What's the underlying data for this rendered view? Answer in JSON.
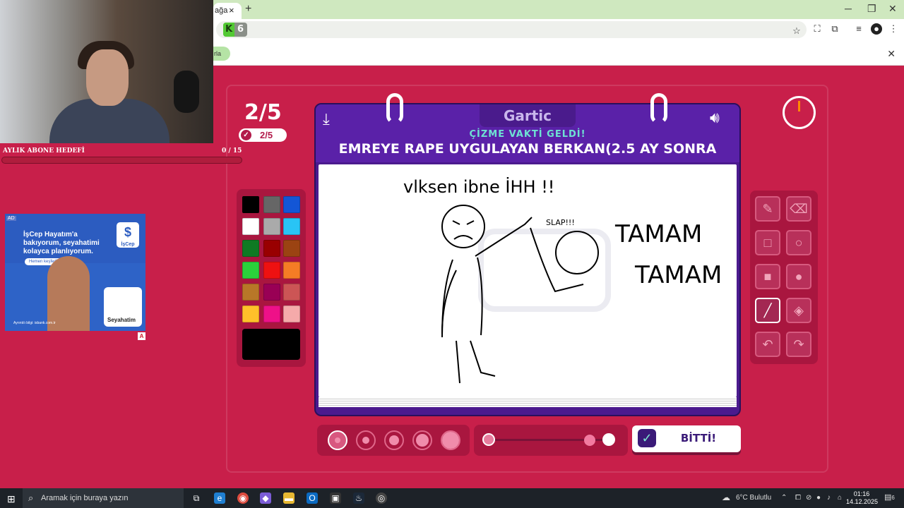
{
  "browser": {
    "tab_label": "ağa",
    "tab_close": "×",
    "new_tab": "+",
    "window_controls": [
      "─",
      "❐",
      "✕"
    ],
    "address_badge_count": "6",
    "bookmark_chip": "rla",
    "bar_close": "✕"
  },
  "stream": {
    "sub_goal_label": "AYLIK ABONE HEDEFİ",
    "sub_goal_count": "0  / 15",
    "ad": {
      "tag": "AD",
      "headline": "İşCep Hayatım'a bakıyorum, seyahatimi kolayca planlıyorum.",
      "cta": "Hemen keşfedin",
      "logo_text": "İşCep",
      "card_title": "Seyahatim",
      "footer": "Ayrıntılı bilgi: isbank.com.tr",
      "badge": "A"
    }
  },
  "game": {
    "round_big": "2/5",
    "round_small": "2/5",
    "logo": "Gartic",
    "subtitle": "ÇİZME VAKTİ GELDİ!",
    "prompt": "EMREYE RAPE UYGULAYAN BERKAN(2.5 AY SONRA",
    "done_label": "BİTTİ!",
    "palette": [
      "#000000",
      "#666666",
      "#1356d6",
      "#ffffff",
      "#aaaaaa",
      "#29c4f5",
      "#0f7a23",
      "#990000",
      "#9b4312",
      "#2bd13b",
      "#ee1111",
      "#f57c25",
      "#b87728",
      "#990055",
      "#cc5555",
      "#ffc12a",
      "#ee1188",
      "#f5aaaa"
    ],
    "current_color": "#000000",
    "tools": [
      {
        "name": "pencil-tool",
        "icon": "✎"
      },
      {
        "name": "eraser-tool",
        "icon": "⌫"
      },
      {
        "name": "rectangle-tool",
        "icon": "□"
      },
      {
        "name": "ellipse-tool",
        "icon": "○"
      },
      {
        "name": "filled-rectangle-tool",
        "icon": "■"
      },
      {
        "name": "filled-ellipse-tool",
        "icon": "●"
      },
      {
        "name": "line-tool",
        "icon": "╱"
      },
      {
        "name": "fill-tool",
        "icon": "◈"
      },
      {
        "name": "undo-tool",
        "icon": "↶"
      },
      {
        "name": "redo-tool",
        "icon": "↷"
      }
    ],
    "active_tool": "line-tool",
    "canvas_text": {
      "top": "vlksen ibne İHH !!",
      "side1": "TAMAM",
      "side2": "TAMAM",
      "slap": "SLAP!!!"
    }
  },
  "taskbar": {
    "search_placeholder": "Aramak için buraya yazın",
    "weather": "6°C  Bulutlu",
    "time": "01:16",
    "date": "14.12.2025",
    "notif_count": "6"
  }
}
